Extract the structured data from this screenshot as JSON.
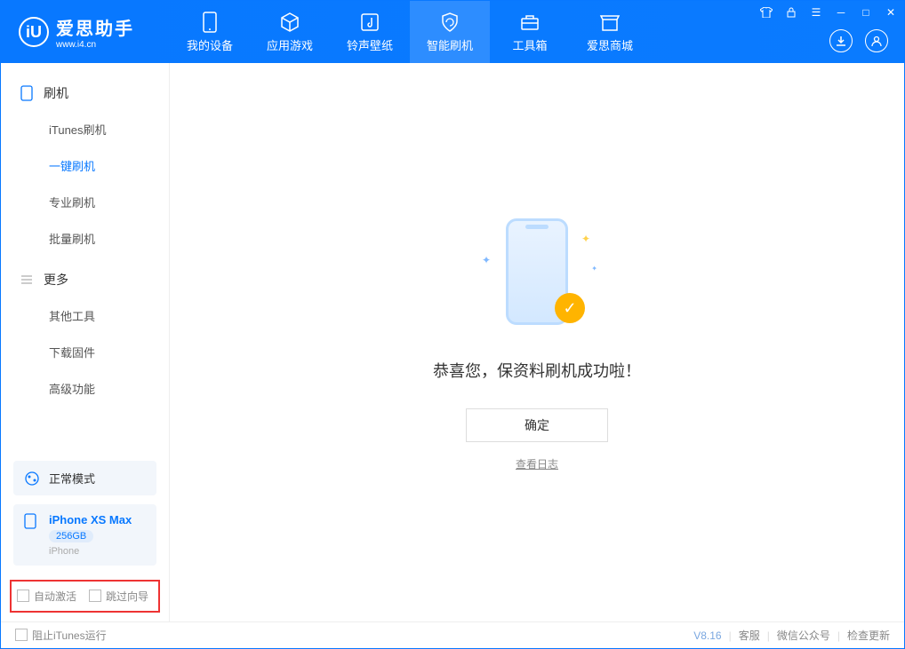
{
  "brand": {
    "name": "爱思助手",
    "url": "www.i4.cn"
  },
  "nav": {
    "tabs": [
      {
        "label": "我的设备"
      },
      {
        "label": "应用游戏"
      },
      {
        "label": "铃声壁纸"
      },
      {
        "label": "智能刷机"
      },
      {
        "label": "工具箱"
      },
      {
        "label": "爱思商城"
      }
    ]
  },
  "sidebar": {
    "group1_title": "刷机",
    "group1_items": [
      {
        "label": "iTunes刷机"
      },
      {
        "label": "一键刷机"
      },
      {
        "label": "专业刷机"
      },
      {
        "label": "批量刷机"
      }
    ],
    "group2_title": "更多",
    "group2_items": [
      {
        "label": "其他工具"
      },
      {
        "label": "下载固件"
      },
      {
        "label": "高级功能"
      }
    ],
    "mode_label": "正常模式",
    "device": {
      "name": "iPhone XS Max",
      "capacity": "256GB",
      "type": "iPhone"
    },
    "opt_auto_activate": "自动激活",
    "opt_skip_guide": "跳过向导"
  },
  "main": {
    "success_text": "恭喜您，保资料刷机成功啦！",
    "ok_button": "确定",
    "view_log": "查看日志"
  },
  "statusbar": {
    "block_itunes": "阻止iTunes运行",
    "version": "V8.16",
    "support": "客服",
    "wechat": "微信公众号",
    "update": "检查更新"
  }
}
